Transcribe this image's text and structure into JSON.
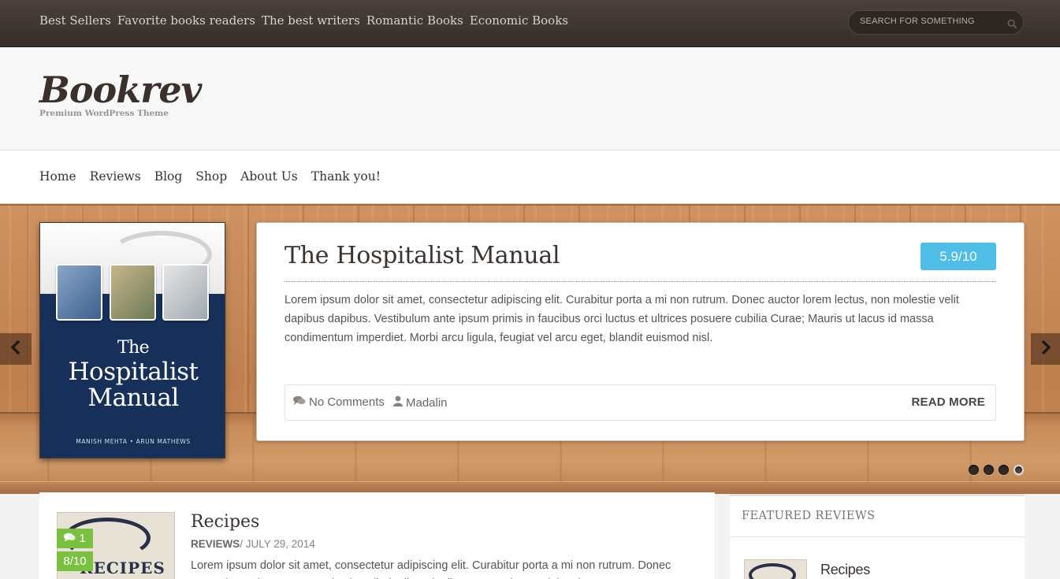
{
  "topbar": {
    "links": [
      "Best Sellers",
      "Favorite books readers",
      "The best writers",
      "Romantic Books",
      "Economic Books"
    ],
    "search_placeholder": "SEARCH FOR SOMETHING"
  },
  "header": {
    "logo": "Bookrev",
    "tagline": "Premium WordPress Theme"
  },
  "menu": {
    "items": [
      "Home",
      "Reviews",
      "Blog",
      "Shop",
      "About Us",
      "Thank you!"
    ]
  },
  "slider": {
    "book_cover": {
      "title_line1": "The",
      "title_line2": "Hospitalist",
      "title_line3": "Manual",
      "authors": "MANISH MEHTA • ARUN MATHEWS"
    },
    "title": "The Hospitalist Manual",
    "score": "5.9/10",
    "excerpt": "Lorem ipsum dolor sit amet, consectetur adipiscing elit. Curabitur porta a mi non rutrum. Donec auctor lorem lectus, non molestie velit dapibus dapibus. Vestibulum ante ipsum primis in faucibus orci luctus et ultrices posuere cubilia Curae; Mauris ut lacus id massa condimentum imperdiet. Morbi arcu ligula, feugiat vel arcu eget, blandit euismod nisl.",
    "comments": "No Comments",
    "author": "Madalin",
    "read_more": "READ MORE",
    "dot_count": 4,
    "active_dot": 4,
    "colors": {
      "score_bg": "#50bde6"
    }
  },
  "post": {
    "title": "Recipes",
    "category": "REVIEWS",
    "date": "/ JULY 29, 2014",
    "excerpt": "Lorem ipsum dolor sit amet, consectetur adipiscing elit. Curabitur porta a mi non rutrum. Donec auctor lorem lectus, non molestie velit dapibus dapibus. Lorem ipsum dolor sit amet, consectetur",
    "comment_count": "1",
    "score": "8/10",
    "thumb_text": "RECIPES",
    "colors": {
      "badge_bg": "#7ac142"
    }
  },
  "sidebar": {
    "title": "FEATURED REVIEWS",
    "items": [
      {
        "title": "Recipes"
      }
    ]
  }
}
